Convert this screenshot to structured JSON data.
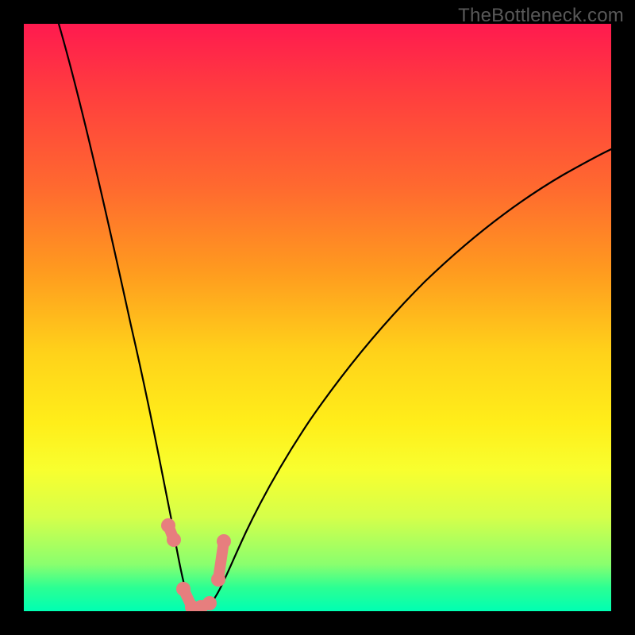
{
  "watermark": "TheBottleneck.com",
  "colors": {
    "frame": "#000000",
    "curve": "#000000",
    "dot": "#e77e7e",
    "gradient_top": "#ff1a4f",
    "gradient_bottom": "#00ffb3"
  },
  "chart_data": {
    "type": "line",
    "title": "",
    "xlabel": "",
    "ylabel": "",
    "xlim": [
      0,
      100
    ],
    "ylim": [
      0,
      100
    ],
    "grid": false,
    "legend": null,
    "background": "rainbow-vertical (red top → green bottom)",
    "note": "Values estimated from pixel positions on a 0–100 scale; y increases upward. Curve is a V-shaped dip to ~0 near x≈29 then rises toward the right edge.",
    "series": [
      {
        "name": "bottleneck-curve",
        "x": [
          6,
          10,
          14,
          18,
          22,
          24,
          26,
          27,
          28,
          29,
          30,
          31,
          32,
          34,
          36,
          40,
          45,
          50,
          55,
          60,
          65,
          70,
          75,
          80,
          85,
          90,
          95,
          100
        ],
        "y": [
          100,
          84,
          67,
          50,
          33,
          24,
          15,
          9,
          4,
          0,
          0,
          1,
          3,
          7,
          12,
          21,
          31,
          39,
          47,
          53,
          59,
          64,
          68,
          72,
          75,
          78,
          80,
          82
        ]
      }
    ],
    "highlight_points": {
      "name": "pink-markers",
      "note": "Cluster of highlighted points along the trough of the curve (coral/pink dots).",
      "x": [
        24.5,
        25.5,
        27.0,
        28.5,
        30.0,
        31.5,
        33.0,
        34.0
      ],
      "y": [
        15,
        12,
        4,
        0.5,
        0.5,
        1.5,
        6,
        12
      ]
    }
  }
}
